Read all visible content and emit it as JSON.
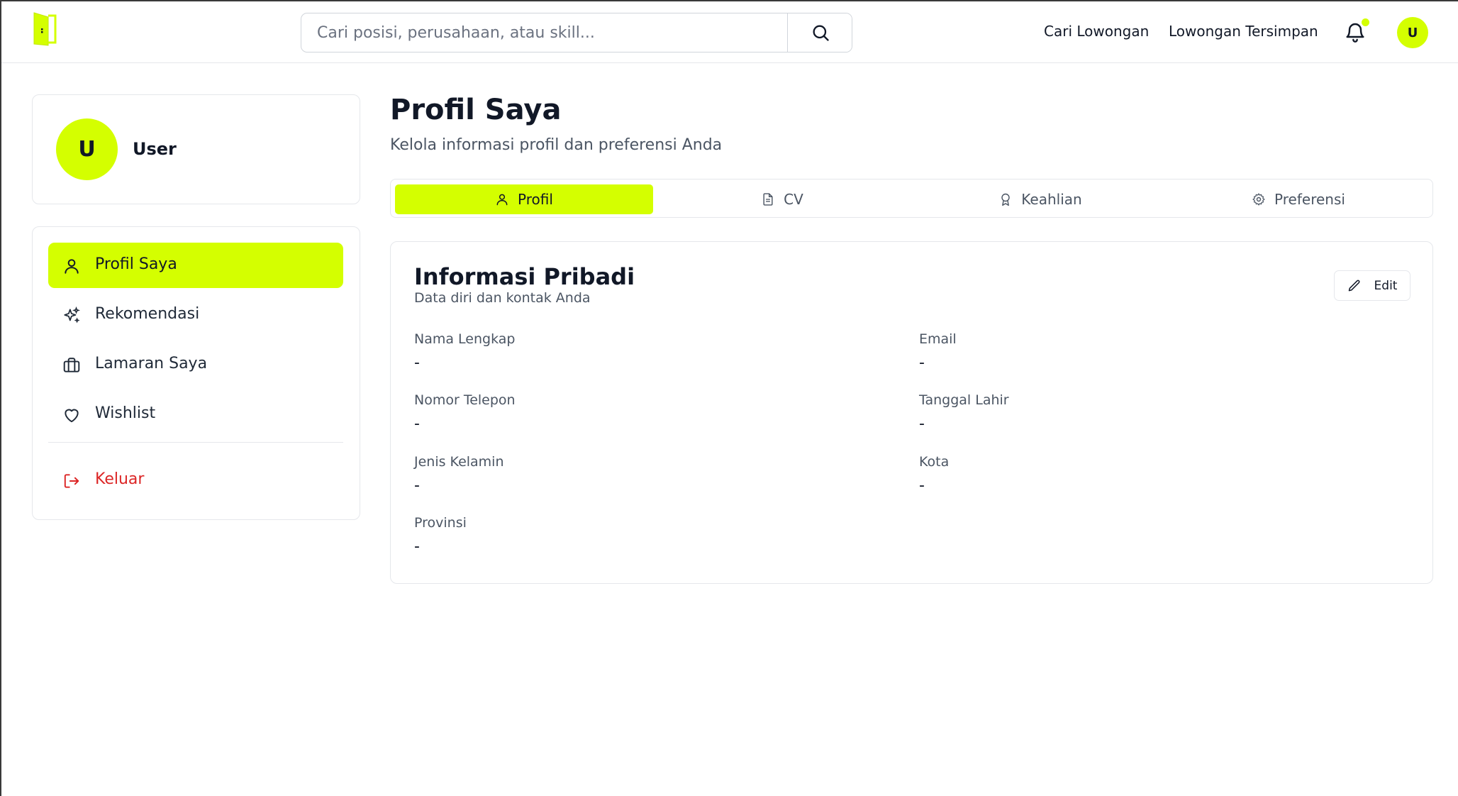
{
  "header": {
    "search": {
      "placeholder": "Cari posisi, perusahaan, atau skill...",
      "value": ""
    },
    "nav": [
      "Cari Lowongan",
      "Lowongan Tersimpan"
    ],
    "avatar_initial": "U",
    "accent_color": "#d4ff00"
  },
  "sidebar": {
    "user": {
      "initial": "U",
      "name": "User"
    },
    "menu": [
      {
        "label": "Profil Saya",
        "icon": "user-icon",
        "active": true
      },
      {
        "label": "Rekomendasi",
        "icon": "sparkles-icon",
        "active": false
      },
      {
        "label": "Lamaran Saya",
        "icon": "briefcase-icon",
        "active": false
      },
      {
        "label": "Wishlist",
        "icon": "heart-icon",
        "active": false
      }
    ],
    "logout": {
      "label": "Keluar",
      "icon": "logout-icon",
      "color": "#dc2626"
    }
  },
  "main": {
    "title": "Profil Saya",
    "subtitle": "Kelola informasi profil dan preferensi Anda",
    "tabs": [
      {
        "label": "Profil",
        "icon": "user-icon",
        "active": true
      },
      {
        "label": "CV",
        "icon": "file-icon",
        "active": false
      },
      {
        "label": "Keahlian",
        "icon": "award-icon",
        "active": false
      },
      {
        "label": "Preferensi",
        "icon": "gear-icon",
        "active": false
      }
    ],
    "info": {
      "title": "Informasi Pribadi",
      "subtitle": "Data diri dan kontak Anda",
      "edit_label": "Edit",
      "fields": [
        {
          "label": "Nama Lengkap",
          "value": "-"
        },
        {
          "label": "Email",
          "value": "-"
        },
        {
          "label": "Nomor Telepon",
          "value": "-"
        },
        {
          "label": "Tanggal Lahir",
          "value": "-"
        },
        {
          "label": "Jenis Kelamin",
          "value": "-"
        },
        {
          "label": "Kota",
          "value": "-"
        },
        {
          "label": "Provinsi",
          "value": "-"
        }
      ]
    }
  }
}
